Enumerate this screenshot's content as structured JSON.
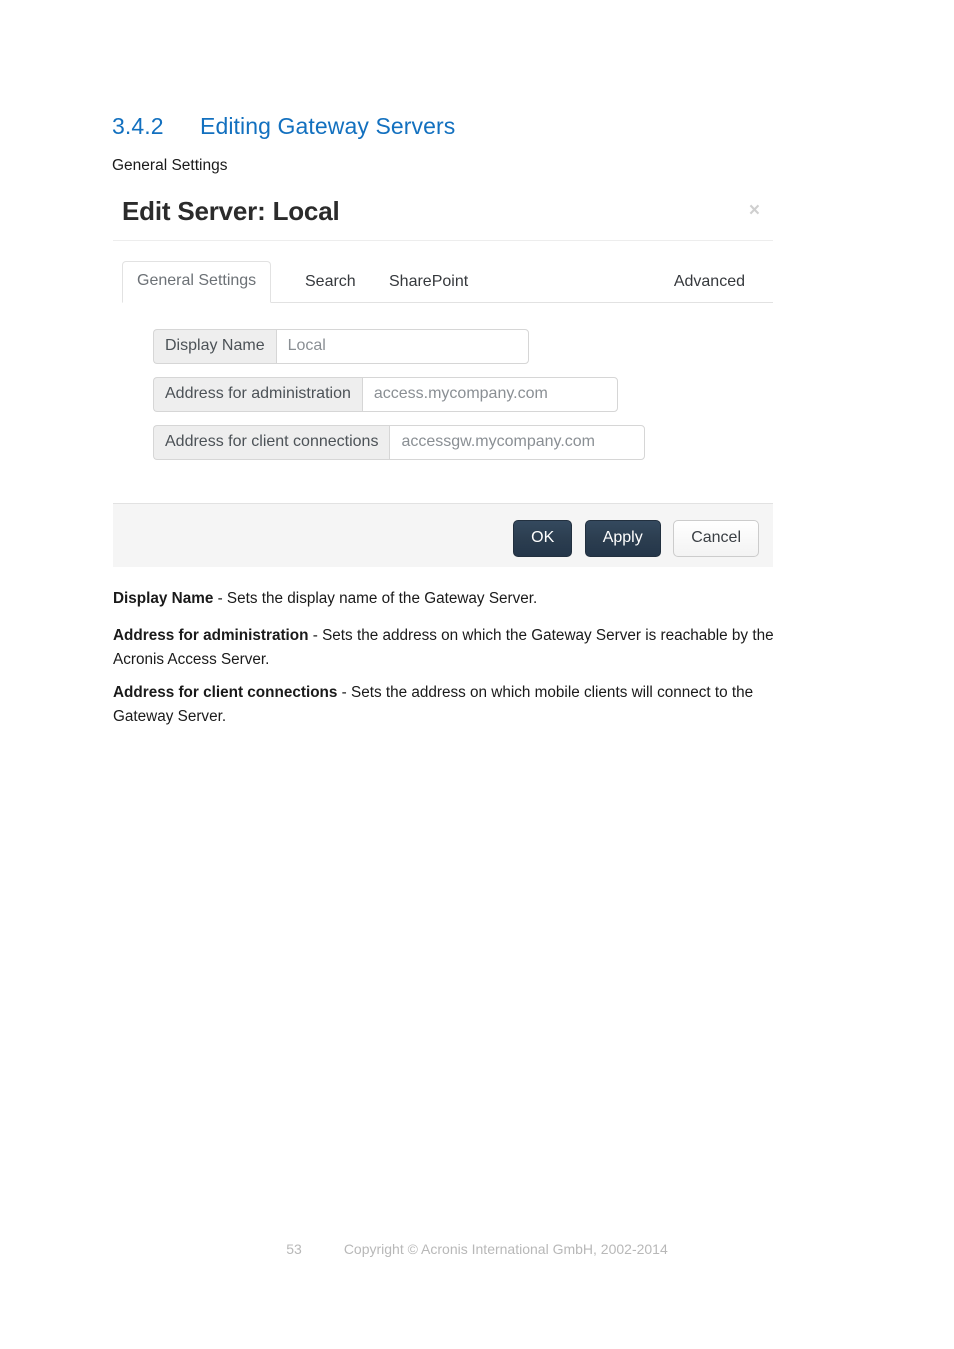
{
  "document": {
    "heading_number": "3.4.2",
    "heading_title": "Editing Gateway Servers",
    "subheading": "General Settings",
    "heading_color": "#1270bf"
  },
  "dialog": {
    "title": "Edit Server: Local",
    "close_icon": "close-icon",
    "close_glyph": "×",
    "tabs": [
      {
        "label": "General Settings",
        "active": true
      },
      {
        "label": "Search",
        "active": false
      },
      {
        "label": "SharePoint",
        "active": false
      },
      {
        "label": "Advanced",
        "active": false
      }
    ],
    "fields": [
      {
        "label": "Display Name",
        "value": "Local",
        "placeholder": "Local"
      },
      {
        "label": "Address for administration",
        "value": "access.mycompany.com",
        "placeholder": "access.mycompany.com"
      },
      {
        "label": "Address for client connections",
        "value": "accessgw.mycompany.com",
        "placeholder": "accessgw.mycompany.com"
      }
    ],
    "buttons": {
      "ok": "OK",
      "apply": "Apply",
      "cancel": "Cancel",
      "primary_color": "#2c3e50"
    }
  },
  "descriptions": [
    {
      "term": "Display Name",
      "text": " - Sets the display name of the Gateway Server."
    },
    {
      "term": "Address for administration",
      "text": " - Sets the address on which the Gateway Server is reachable by the Acronis Access Server."
    },
    {
      "term": "Address for client connections",
      "text": " - Sets the address on which mobile clients will connect to the Gateway Server."
    }
  ],
  "footer": {
    "page_number": "53",
    "copyright": "Copyright © Acronis International GmbH, 2002-2014"
  }
}
